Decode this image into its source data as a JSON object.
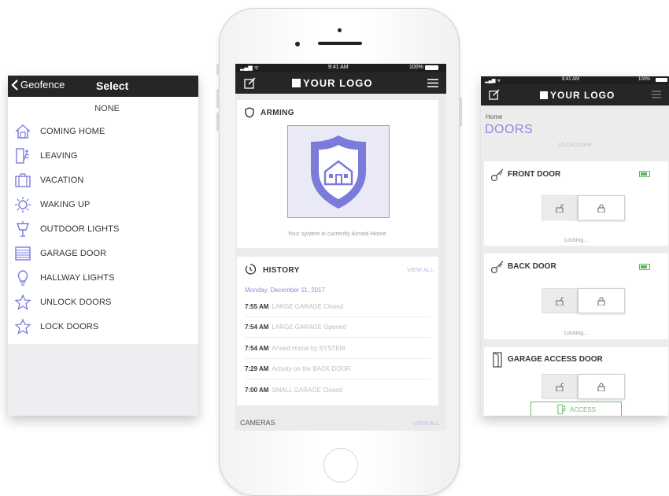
{
  "left_screen": {
    "nav": {
      "back_label": "Geofence",
      "title": "Select"
    },
    "none_label": "NONE",
    "items": [
      {
        "label": "COMING HOME",
        "icon": "house-icon"
      },
      {
        "label": "LEAVING",
        "icon": "exit-door-icon"
      },
      {
        "label": "VACATION",
        "icon": "suitcase-icon"
      },
      {
        "label": "WAKING UP",
        "icon": "sun-icon"
      },
      {
        "label": "OUTDOOR LIGHTS",
        "icon": "outdoor-lamp-icon"
      },
      {
        "label": "GARAGE DOOR",
        "icon": "garage-icon"
      },
      {
        "label": "HALLWAY LIGHTS",
        "icon": "bulb-icon"
      },
      {
        "label": "UNLOCK DOORS",
        "icon": "star-icon"
      },
      {
        "label": "LOCK DOORS",
        "icon": "star-icon"
      }
    ]
  },
  "center_screen": {
    "status": {
      "time": "9:41 AM",
      "battery": "100%"
    },
    "logo": "YOUR LOGO",
    "arming": {
      "title": "ARMING",
      "status_text": "Your system is currently Armed Home."
    },
    "history": {
      "title": "HISTORY",
      "view_all": "VIEW ALL",
      "date": "Monday, December 11, 2017",
      "events": [
        {
          "time": "7:55 AM",
          "text": "LARGE GARAGE Closed"
        },
        {
          "time": "7:54 AM",
          "text": "LARGE GARAGE Opened"
        },
        {
          "time": "7:54 AM",
          "text": "Armed Home by SYSTEM"
        },
        {
          "time": "7:29 AM",
          "text": "Activity on the BACK DOOR"
        },
        {
          "time": "7:00 AM",
          "text": "SMALL GARAGE Closed"
        }
      ]
    },
    "cameras": {
      "title": "CAMERAS",
      "view_all": "VIEW ALL"
    }
  },
  "right_screen": {
    "status": {
      "time": "9:41 AM",
      "battery": "100%"
    },
    "logo": "YOUR LOGO",
    "breadcrumb": "Home",
    "title": "DOORS",
    "lockdown": "LOCKDOWN",
    "doors": [
      {
        "name": "FRONT DOOR",
        "status": "Locking..."
      },
      {
        "name": "BACK DOOR",
        "status": "Locking..."
      },
      {
        "name": "GARAGE ACCESS DOOR",
        "access_label": "ACCESS"
      }
    ]
  },
  "colors": {
    "accent": "#7b7bdc",
    "shield_bg": "#eaeaf7",
    "nav_bg": "#262626",
    "battery_green": "#5cb85c",
    "access_green": "#6cbf6c"
  }
}
